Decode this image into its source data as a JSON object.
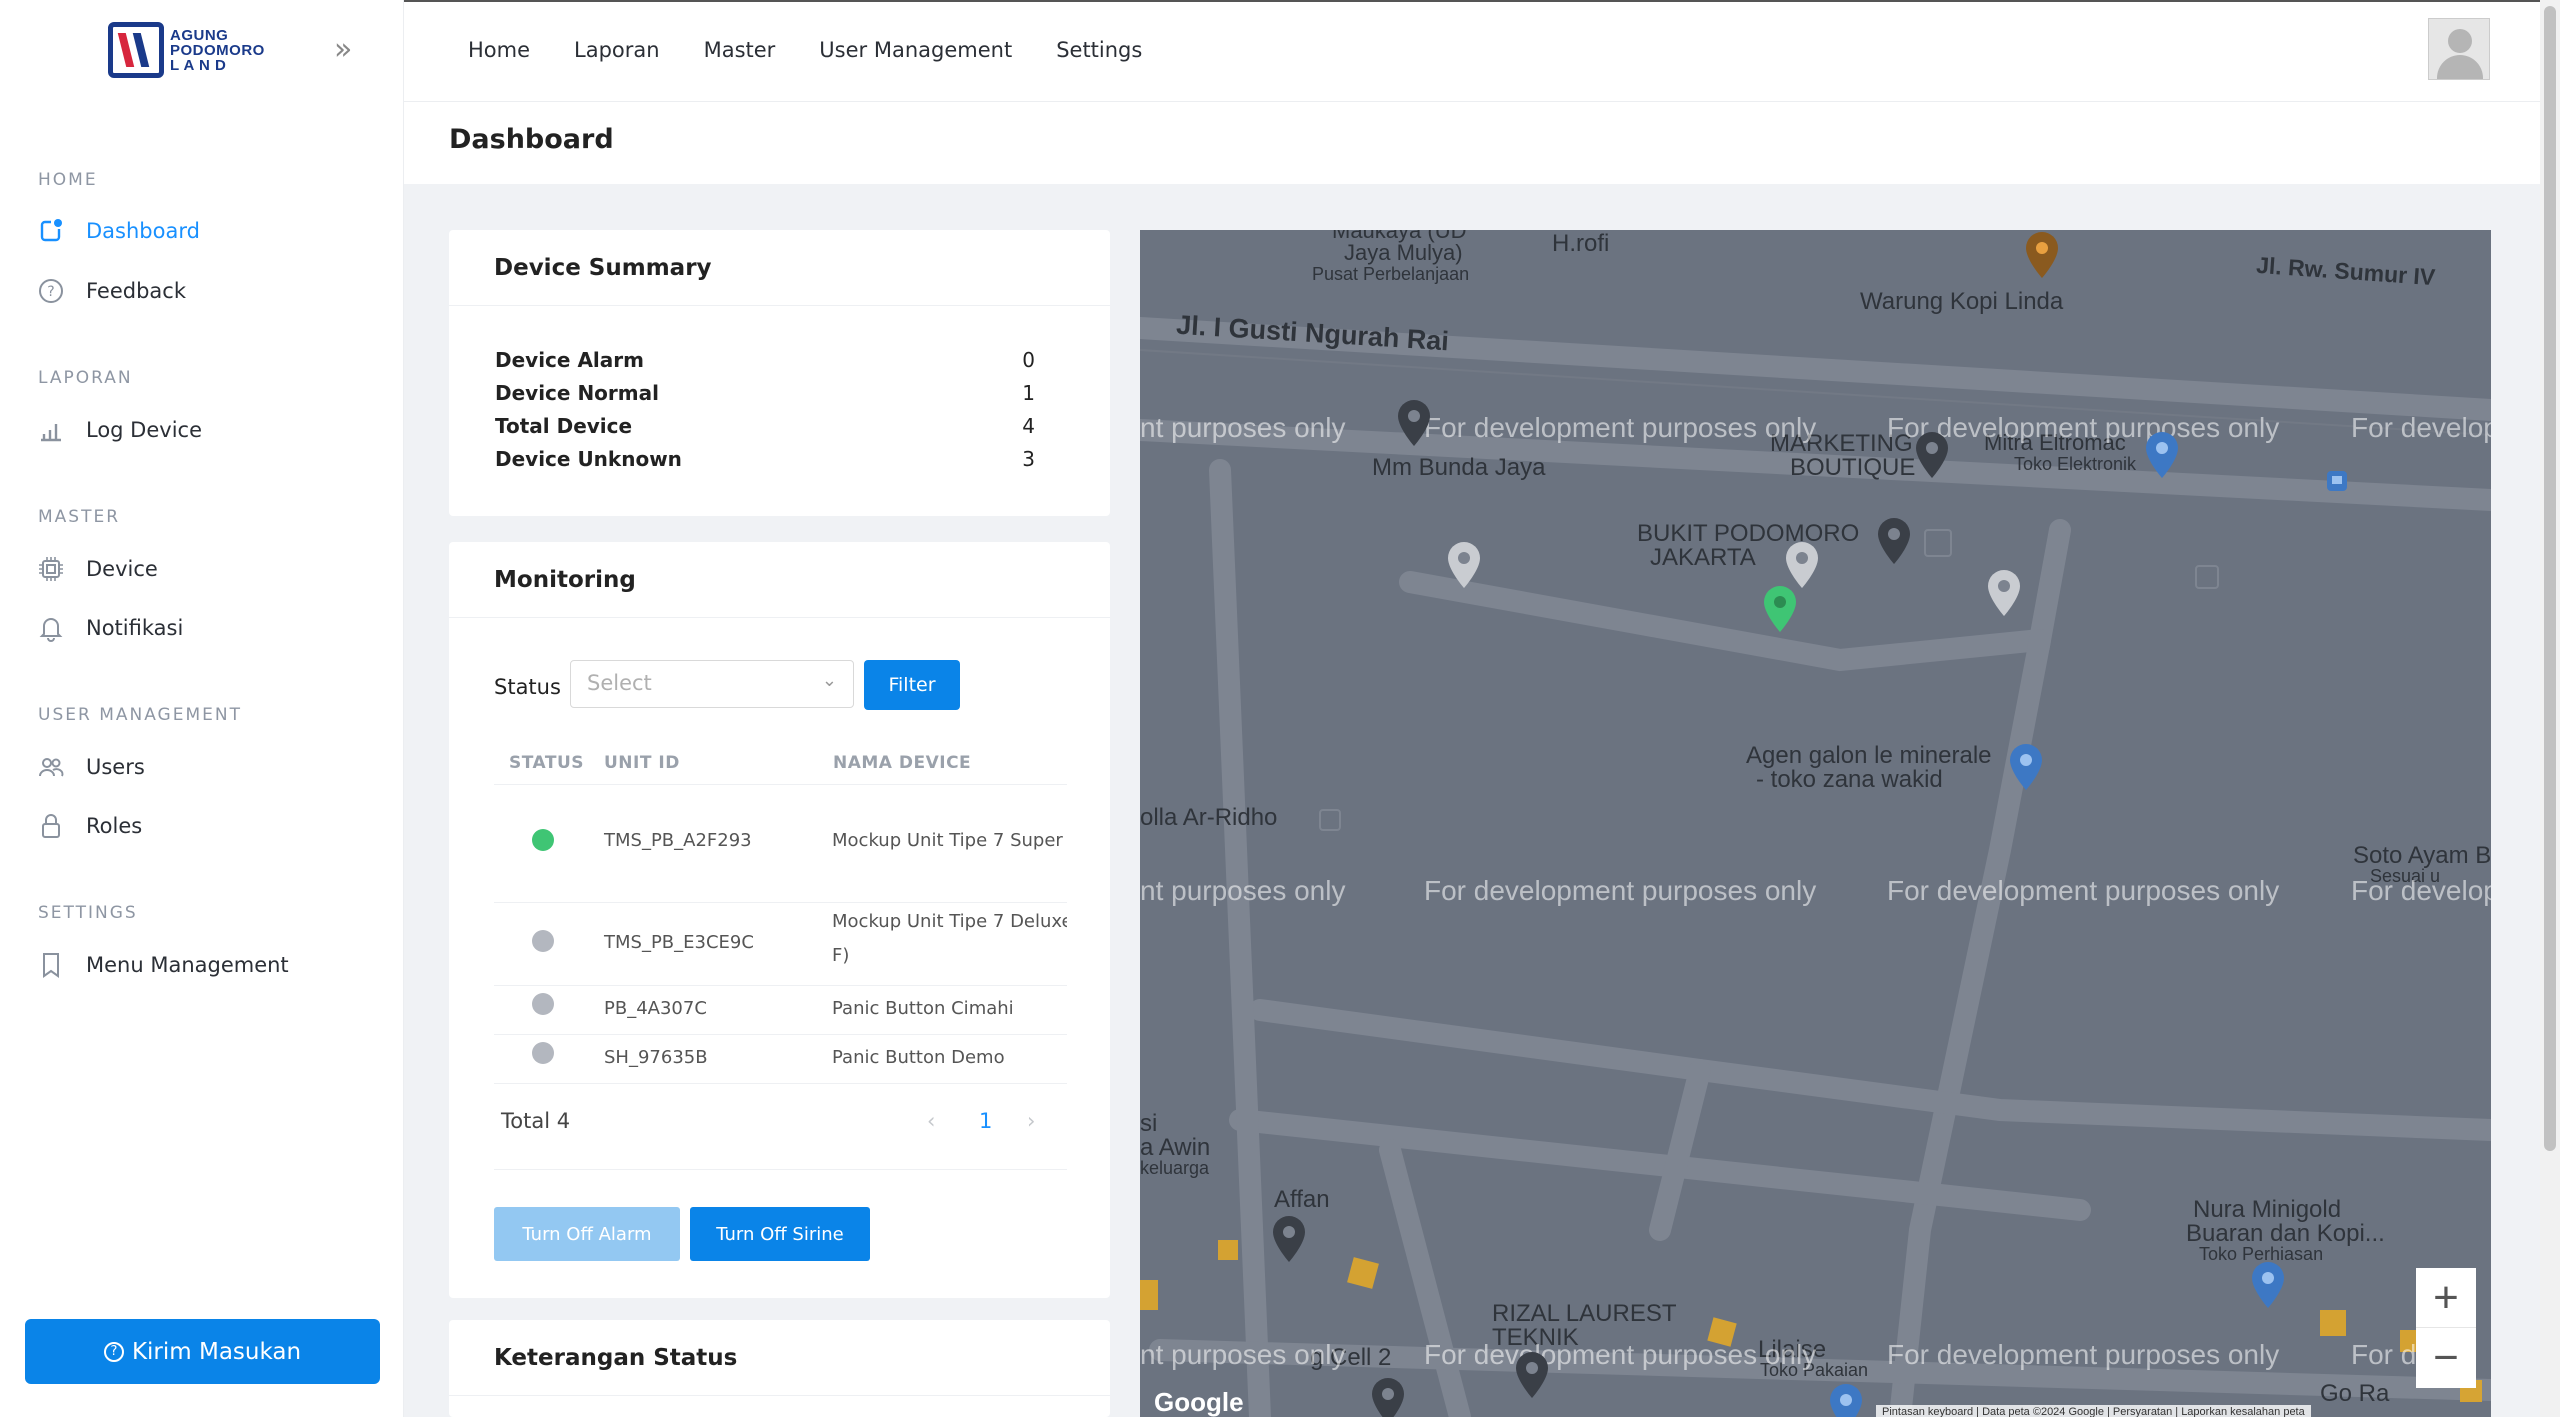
{
  "logo": {
    "line1": "AGUNG",
    "line2": "PODOMORO",
    "line3": "L A N D"
  },
  "sidebar": {
    "sections": [
      {
        "title": "HOME",
        "items": [
          {
            "label": "Dashboard",
            "icon": "dashboard-icon",
            "active": true
          },
          {
            "label": "Feedback",
            "icon": "question-icon"
          }
        ]
      },
      {
        "title": "LAPORAN",
        "items": [
          {
            "label": "Log Device",
            "icon": "bar-chart-icon"
          }
        ]
      },
      {
        "title": "MASTER",
        "items": [
          {
            "label": "Device",
            "icon": "chip-icon"
          },
          {
            "label": "Notifikasi",
            "icon": "bell-icon"
          }
        ]
      },
      {
        "title": "USER MANAGEMENT",
        "items": [
          {
            "label": "Users",
            "icon": "users-icon"
          },
          {
            "label": "Roles",
            "icon": "lock-icon"
          }
        ]
      },
      {
        "title": "SETTINGS",
        "items": [
          {
            "label": "Menu Management",
            "icon": "bookmark-icon"
          }
        ]
      }
    ],
    "feedback_button": "Kirim Masukan"
  },
  "topnav": {
    "items": [
      "Home",
      "Laporan",
      "Master",
      "User Management",
      "Settings"
    ]
  },
  "page": {
    "title": "Dashboard"
  },
  "summary": {
    "title": "Device Summary",
    "rows": [
      {
        "label": "Device Alarm",
        "value": "0"
      },
      {
        "label": "Device Normal",
        "value": "1"
      },
      {
        "label": "Total Device",
        "value": "4"
      },
      {
        "label": "Device Unknown",
        "value": "3"
      }
    ]
  },
  "monitoring": {
    "title": "Monitoring",
    "status_label": "Status",
    "select_placeholder": "Select",
    "filter_button": "Filter",
    "columns": [
      "STATUS",
      "UNIT ID",
      "NAMA DEVICE"
    ],
    "rows": [
      {
        "status_color": "#3fc574",
        "unit_id": "TMS_PB_A2F293",
        "name": "Mockup Unit Tipe 7 Super"
      },
      {
        "status_color": "#b3b7bf",
        "unit_id": "TMS_PB_E3CE9C",
        "name": "Mockup Unit Tipe 7 Deluxe",
        "name2": "F)"
      },
      {
        "status_color": "#b3b7bf",
        "unit_id": "PB_4A307C",
        "name": "Panic Button Cimahi"
      },
      {
        "status_color": "#b3b7bf",
        "unit_id": "SH_97635B",
        "name": "Panic Button Demo"
      }
    ],
    "total": "Total 4",
    "page": "1",
    "btn_alarm": "Turn Off Alarm",
    "btn_sirine": "Turn Off Sirine"
  },
  "keterangan": {
    "title": "Keterangan Status"
  },
  "map": {
    "labels": {
      "jaya1": "Maukaya (UD",
      "jaya2": "Jaya Mulya)",
      "pusat": "Pusat Perbelanjaan",
      "hrofi": "H.rofi",
      "warung": "Warung Kopi Linda",
      "sumur": "Jl. Rw. Sumur IV",
      "gusti": "Jl. I Gusti Ngurah Rai",
      "bunda": "Mm Bunda Jaya",
      "marketing1": "MARKETING",
      "marketing2": "BOUTIQUE",
      "mitra": "Mitra Eltromac",
      "toko": "Toko Elektronik",
      "bukit1": "BUKIT PODOMORO",
      "bukit2": "JAKARTA",
      "agen1": "Agen galon le minerale",
      "agen2": "- toko zana wakid",
      "ridho": "olla Ar-Ridho",
      "soto1": "Soto Ayam B",
      "soto2": "Sesuai u",
      "si1": "si",
      "si2": "a Awin",
      "si3": "keluarga",
      "affan": "Affan",
      "nura1": "Nura Minigold",
      "nura2": "Buaran dan Kopi...",
      "nura3": "Toko Perhiasan",
      "rizal1": "RIZAL LAUREST",
      "rizal2": "TEKNIK",
      "cell": "g Cell 2",
      "lilaise1": "Lilaise",
      "lilaise2": "Toko Pakaian",
      "go": "Go Ra"
    },
    "watermark": "For development purposes only",
    "watermark_left": "nt purposes only",
    "watermark_right": "For develop",
    "watermark_right2": "For d",
    "google": "Google",
    "attribution": "Pintasan keyboard | Data peta ©2024 Google | Persyaratan | Laporkan kesalahan peta",
    "zoom_in": "+",
    "zoom_out": "−"
  }
}
